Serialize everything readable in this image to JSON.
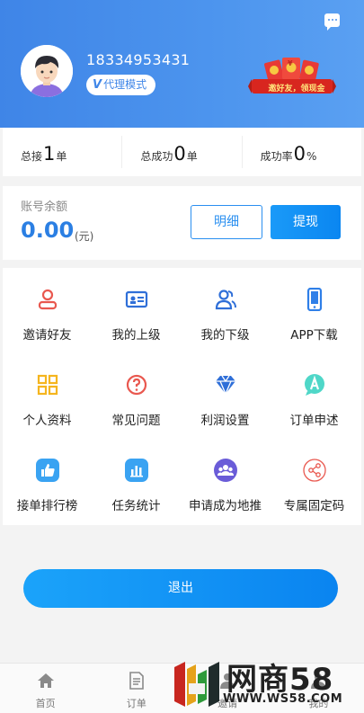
{
  "header": {
    "phone": "18334953431",
    "mode_badge": "代理模式",
    "promo_text": "邀好友，领现金",
    "promo_coin": "¥"
  },
  "stats": [
    {
      "label": "总接",
      "value": "1",
      "unit": "单"
    },
    {
      "label": "总成功",
      "value": "0",
      "unit": "单"
    },
    {
      "label": "成功率",
      "value": "0",
      "unit": "%"
    }
  ],
  "balance": {
    "label": "账号余额",
    "amount": "0.00",
    "unit": "(元)",
    "detail_button": "明细",
    "withdraw_button": "提现"
  },
  "menu": [
    {
      "label": "邀请好友",
      "icon": "person-icon"
    },
    {
      "label": "我的上级",
      "icon": "id-card-icon"
    },
    {
      "label": "我的下级",
      "icon": "users-icon"
    },
    {
      "label": "APP下载",
      "icon": "phone-icon"
    },
    {
      "label": "个人资料",
      "icon": "grid-icon"
    },
    {
      "label": "常见问题",
      "icon": "question-icon"
    },
    {
      "label": "利润设置",
      "icon": "diamond-icon"
    },
    {
      "label": "订单申述",
      "icon": "appeal-icon"
    },
    {
      "label": "接单排行榜",
      "icon": "thumbs-up-icon"
    },
    {
      "label": "任务统计",
      "icon": "bar-chart-icon"
    },
    {
      "label": "申请成为地推",
      "icon": "group-icon"
    },
    {
      "label": "专属固定码",
      "icon": "share-icon"
    }
  ],
  "logout_button": "退出",
  "tabs": [
    {
      "label": "首页",
      "icon": "home-icon"
    },
    {
      "label": "订单",
      "icon": "document-icon"
    },
    {
      "label": "邀请",
      "icon": "invite-icon"
    },
    {
      "label": "我的",
      "icon": "user-icon"
    }
  ],
  "watermark": {
    "text": "网商58",
    "url": "WWW.WS58.COM"
  },
  "colors": {
    "brand_blue": "#3f85e7",
    "accent_blue": "#0a86f1",
    "red_icon": "#e9584f",
    "yellow_icon": "#f5b51e"
  }
}
